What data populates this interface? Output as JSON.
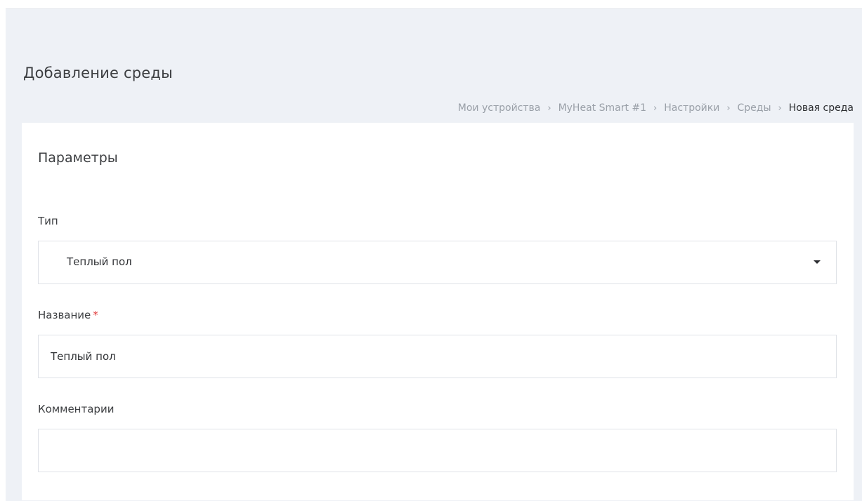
{
  "page": {
    "title": "Добавление среды"
  },
  "breadcrumb": {
    "items": [
      "Мои устройства",
      "MyHeat Smart #1",
      "Настройки",
      "Среды"
    ],
    "separator": "›",
    "current": "Новая среда"
  },
  "card": {
    "title": "Параметры"
  },
  "form": {
    "type_label": "Тип",
    "type_value": "Теплый пол",
    "name_label": "Название",
    "name_required_mark": "*",
    "name_value": "Теплый пол",
    "comment_label": "Комментарии",
    "comment_value": ""
  },
  "colors": {
    "background": "#eef1f6",
    "card": "#ffffff",
    "required": "#e03a3a",
    "border": "#dfe2e7"
  },
  "icons": {
    "dropdown": "caret-down-icon"
  }
}
